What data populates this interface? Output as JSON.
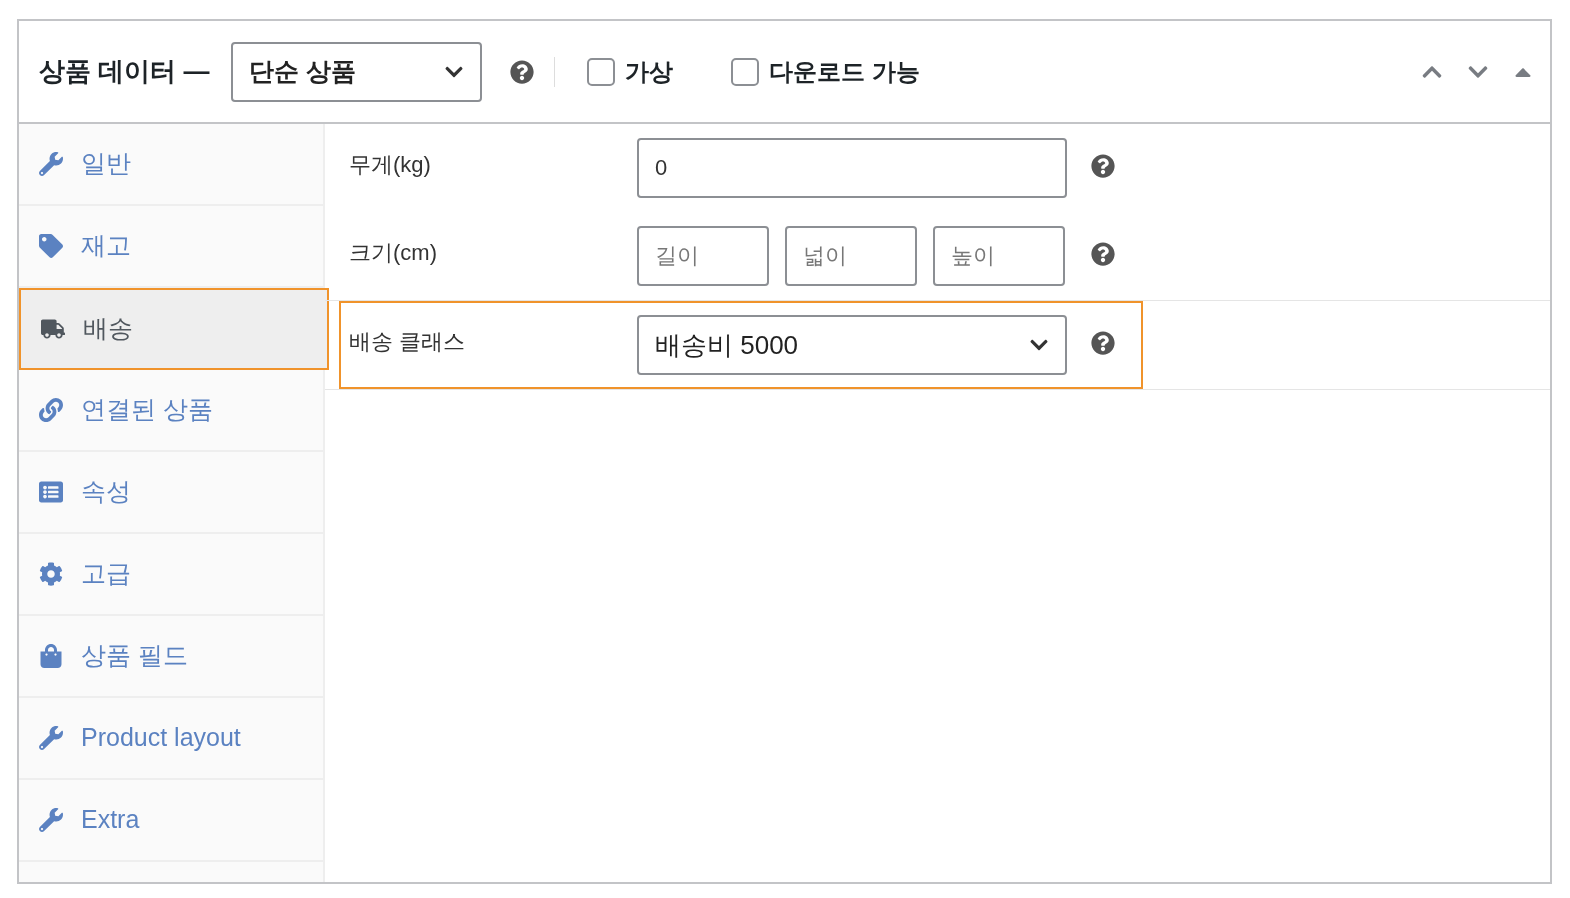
{
  "header": {
    "title": "상품 데이터 —",
    "product_type": "단순 상품",
    "options": [
      {
        "label": "가상",
        "checked": false
      },
      {
        "label": "다운로드 가능",
        "checked": false
      }
    ]
  },
  "sidebar": {
    "items": [
      {
        "label": "일반",
        "selected": false
      },
      {
        "label": "재고",
        "selected": false
      },
      {
        "label": "배송",
        "selected": true
      },
      {
        "label": "연결된 상품",
        "selected": false
      },
      {
        "label": "속성",
        "selected": false
      },
      {
        "label": "고급",
        "selected": false
      },
      {
        "label": "상품 필드",
        "selected": false
      },
      {
        "label": "Product layout",
        "selected": false
      },
      {
        "label": "Extra",
        "selected": false
      }
    ]
  },
  "fields": [
    {
      "kind": "text",
      "label": "무게(kg)",
      "value": "0",
      "highlighted": false
    },
    {
      "kind": "dimensions",
      "label": "크기(cm)",
      "placeholders": [
        "길이",
        "넓이",
        "높이"
      ],
      "highlighted": false
    },
    {
      "kind": "select",
      "label": "배송 클래스",
      "value": "배송비 5000",
      "highlighted": true
    }
  ]
}
